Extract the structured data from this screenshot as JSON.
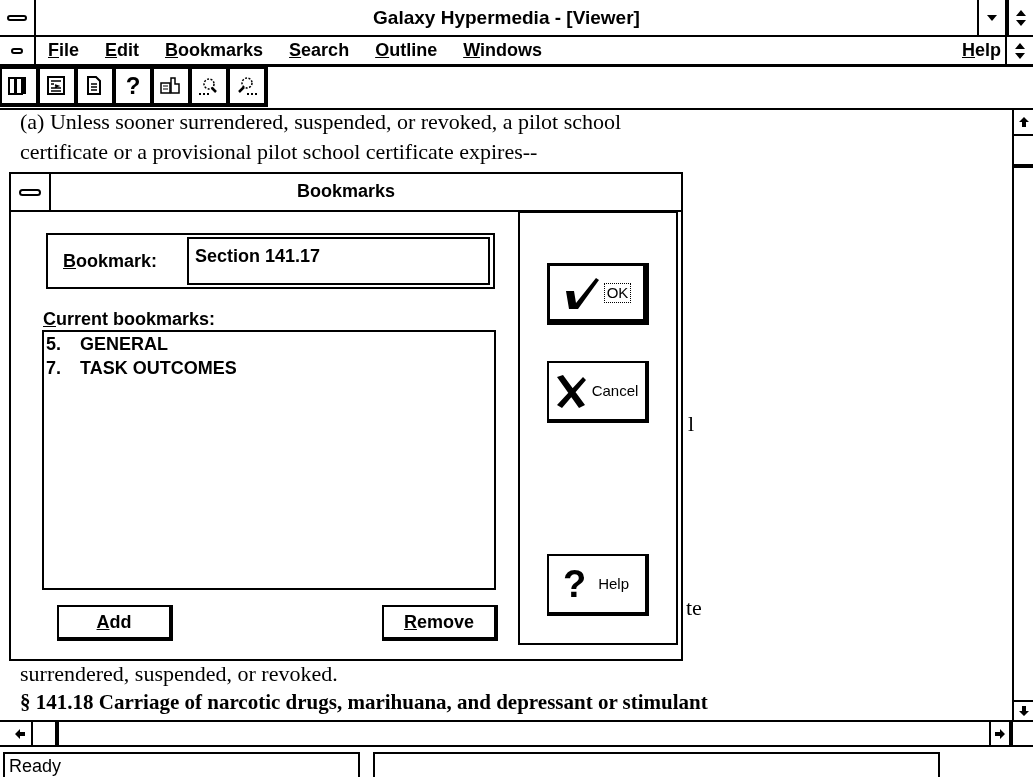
{
  "window": {
    "title": "Galaxy Hypermedia - [Viewer]"
  },
  "menu": [
    {
      "label": "File"
    },
    {
      "label": "Edit"
    },
    {
      "label": "Bookmarks"
    },
    {
      "label": "Search"
    },
    {
      "label": "Outline"
    },
    {
      "label": "Windows"
    },
    {
      "label": "Help",
      "kind": "right"
    }
  ],
  "toolbar": [
    {
      "kind": "library"
    },
    {
      "kind": "outline"
    },
    {
      "kind": "page"
    },
    {
      "kind": "glyph",
      "glyph": "?"
    },
    {
      "kind": "notes"
    },
    {
      "kind": "find-back"
    },
    {
      "kind": "find-next"
    }
  ],
  "document": {
    "lines": [
      {
        "kind": "text",
        "text": "(a) Unless sooner surrendered, suspended, or revoked, a pilot school"
      },
      {
        "kind": "text",
        "text": "certificate or a provisional pilot school certificate expires--"
      },
      {
        "kind": "fragment",
        "text": "l"
      },
      {
        "kind": "fragment",
        "text": "te"
      },
      {
        "kind": "text",
        "text": "surrendered, suspended, or revoked."
      },
      {
        "kind": "heading",
        "text": "§ 141.18  Carriage of narcotic drugs, marihuana, and depressant or stimulant"
      }
    ]
  },
  "dialog": {
    "title": "Bookmarks",
    "bookmark_label": "Bookmark:",
    "bookmark_value": "Section 141.17",
    "list_label": "Current bookmarks:",
    "bookmarks": [
      {
        "number": "5.",
        "title": "GENERAL",
        "selected": false
      },
      {
        "number": "7.",
        "title": "TASK OUTCOMES",
        "selected": false
      }
    ],
    "buttons": [
      {
        "label": "Add"
      },
      {
        "label": "Remove"
      }
    ],
    "side_buttons": [
      {
        "kind": "ok",
        "label": "OK",
        "focused": true
      },
      {
        "kind": "cancel",
        "label": "Cancel",
        "focused": false
      },
      {
        "kind": "help",
        "label": "Help",
        "glyph": "?",
        "focused": false
      }
    ]
  },
  "status_bar": {
    "message": "Ready"
  }
}
